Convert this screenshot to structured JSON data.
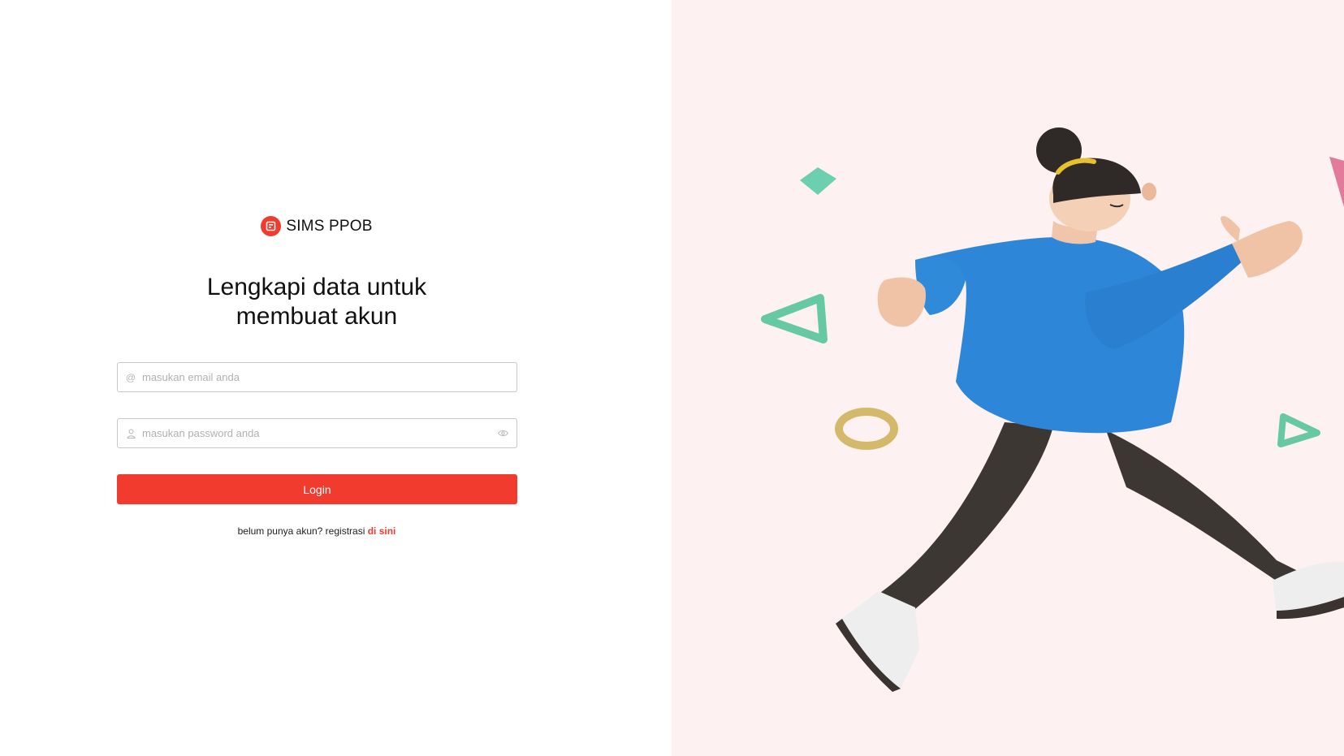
{
  "brand": {
    "name": "SIMS PPOB",
    "accent": "#f13b2f"
  },
  "page_title": {
    "line1": "Lengkapi data untuk",
    "line2": "membuat akun"
  },
  "form": {
    "email": {
      "placeholder": "masukan email anda",
      "value": "",
      "icon": "at-icon"
    },
    "password": {
      "placeholder": "masukan password anda",
      "value": "",
      "icon": "user-icon",
      "toggle_icon": "eye-icon"
    },
    "login_label": "Login"
  },
  "signup": {
    "prefix": "belum punya akun? registrasi ",
    "link_label": "di sini"
  },
  "illustration": {
    "subject": "running person",
    "background": "#fdf1f1"
  }
}
